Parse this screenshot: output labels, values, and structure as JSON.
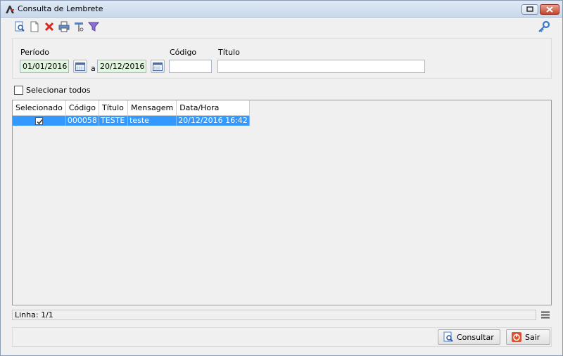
{
  "window": {
    "title": "Consulta de Lembrete",
    "restore_icon": "restore-icon",
    "close_icon": "close-icon"
  },
  "toolbar": {
    "buttons": [
      {
        "name": "search-document-icon"
      },
      {
        "name": "new-document-icon"
      },
      {
        "name": "delete-icon"
      },
      {
        "name": "print-icon"
      },
      {
        "name": "tools-icon"
      },
      {
        "name": "filter-icon"
      }
    ],
    "key_icon": "key-icon"
  },
  "filters": {
    "periodo_label": "Período",
    "date_from": "01/01/2016",
    "date_sep": "a",
    "date_to": "20/12/2016",
    "codigo_label": "Código",
    "codigo_value": "",
    "titulo_label": "Título",
    "titulo_value": ""
  },
  "select_all": {
    "label": "Selecionar todos",
    "checked": false
  },
  "grid": {
    "columns": [
      "Selecionado",
      "Código",
      "Título",
      "Mensagem",
      "Data/Hora"
    ],
    "rows": [
      {
        "selecionado": true,
        "codigo": "000058",
        "titulo": "TESTE",
        "mensagem": "teste",
        "data_hora": "20/12/2016 16:42"
      }
    ]
  },
  "status": {
    "linha": "Linha: 1/1"
  },
  "actions": {
    "consultar": "Consultar",
    "sair": "Sair"
  },
  "colors": {
    "selection": "#3399ff",
    "date_field": "#e2f5e0"
  }
}
